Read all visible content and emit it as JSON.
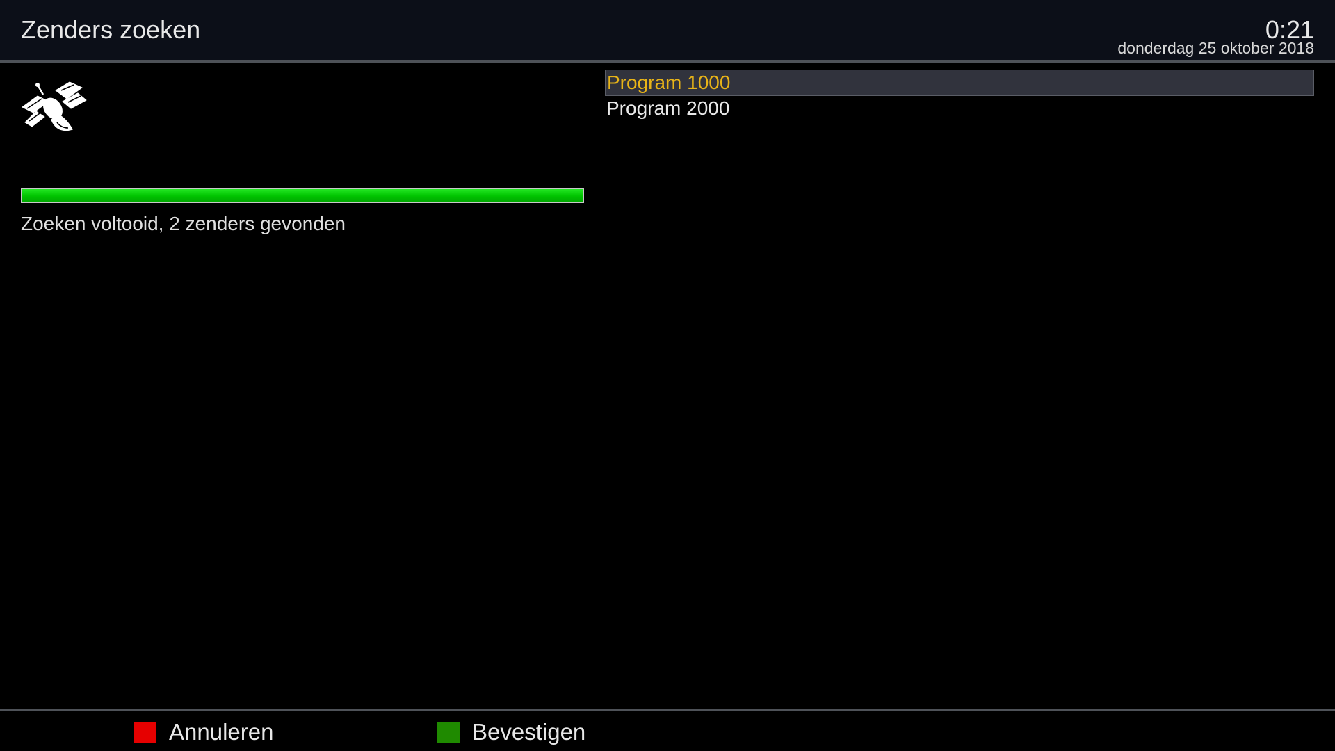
{
  "header": {
    "title": "Zenders zoeken",
    "clock": "0:21",
    "date": "donderdag 25 oktober 2018"
  },
  "scan": {
    "icon": "satellite-icon",
    "progress_percent": 100,
    "progress_color": "#00c400",
    "status": "Zoeken voltooid, 2 zenders gevonden"
  },
  "channels": {
    "items": [
      {
        "label": "Program 1000",
        "selected": true
      },
      {
        "label": "Program 2000",
        "selected": false
      }
    ],
    "selected_color": "#e8b418"
  },
  "footer": {
    "red_key": {
      "label": "Annuleren",
      "color": "#e60000"
    },
    "green_key": {
      "label": "Bevestigen",
      "color": "#1f8a00"
    }
  }
}
